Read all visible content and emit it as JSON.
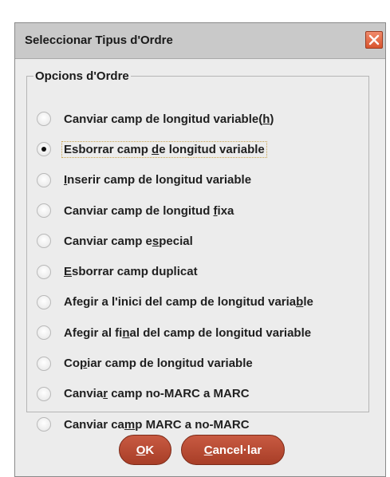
{
  "dialog": {
    "title": "Seleccionar Tipus d'Ordre",
    "group_title": "Opcions d'Ordre",
    "options": [
      {
        "pre": "Canviar camp de longitud variable(",
        "mn": "h",
        "post": ")",
        "checked": false
      },
      {
        "pre": "Esborrar camp ",
        "mn": "d",
        "post": "e longitud variable",
        "checked": true
      },
      {
        "pre": "",
        "mn": "I",
        "post": "nserir camp de longitud variable",
        "checked": false
      },
      {
        "pre": "Canviar camp de longitud ",
        "mn": "f",
        "post": "ixa",
        "checked": false
      },
      {
        "pre": "Canviar camp e",
        "mn": "s",
        "post": "pecial",
        "checked": false
      },
      {
        "pre": "",
        "mn": "E",
        "post": "sborrar camp duplicat",
        "checked": false
      },
      {
        "pre": "Afegir a l'inici del camp de longitud varia",
        "mn": "b",
        "post": "le",
        "checked": false
      },
      {
        "pre": "Afegir al fi",
        "mn": "n",
        "post": "al del camp de longitud variable",
        "checked": false
      },
      {
        "pre": "Co",
        "mn": "p",
        "post": "iar camp de longitud variable",
        "checked": false
      },
      {
        "pre": "Canvia",
        "mn": "r",
        "post": " camp no-MARC a MARC",
        "checked": false
      },
      {
        "pre": "Canviar ca",
        "mn": "m",
        "post": "p MARC a no-MARC",
        "checked": false
      }
    ],
    "ok": {
      "mn": "O",
      "post": "K"
    },
    "cancel": {
      "mn": "C",
      "post": "ancel·lar"
    }
  },
  "colors": {
    "button": "#b84a33",
    "close": "#e06a46",
    "titlebar": "#c9c9c9"
  },
  "icons": {
    "close": "close-icon"
  }
}
